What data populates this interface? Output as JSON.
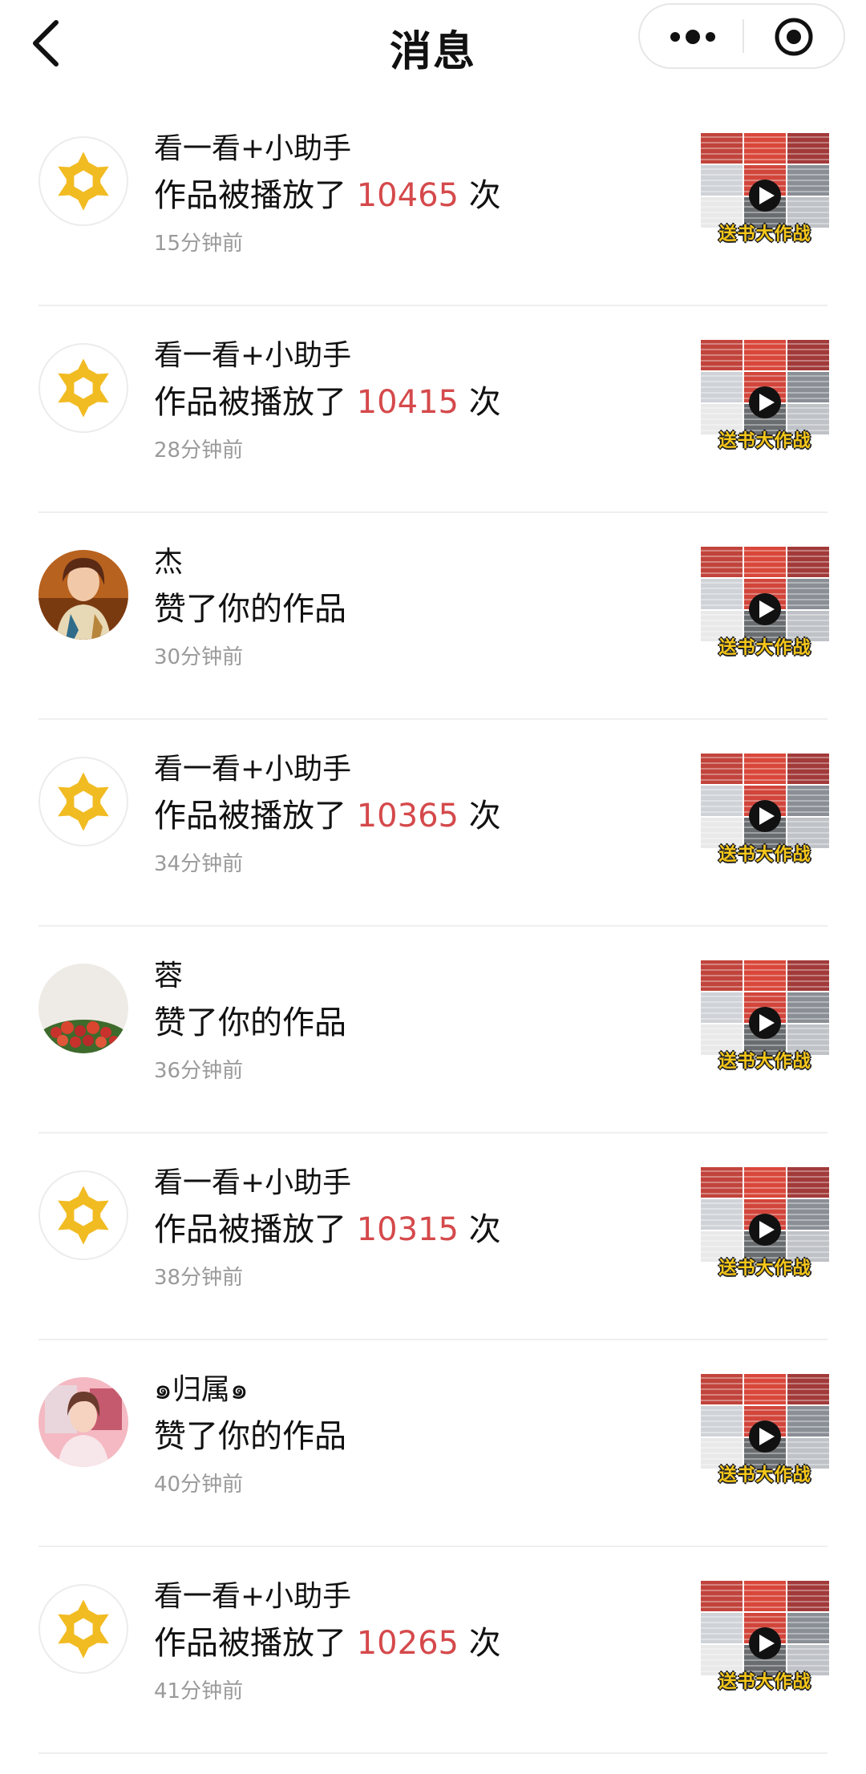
{
  "header": {
    "title": "消息",
    "back_icon": "back-icon",
    "menu_icon": "more-dots-icon",
    "close_icon": "record-icon"
  },
  "colors": {
    "accent_count": "#d5494b",
    "assistant_logo": "#f1bb22",
    "secondary_text": "#9a9a9a"
  },
  "thumbnail": {
    "caption": "送书大作战",
    "play_icon": "play-icon"
  },
  "messages": [
    {
      "sender": "看一看+小助手",
      "text_prefix": "作品被播放了 ",
      "count": "10465",
      "text_suffix": " 次",
      "time": "15分钟前",
      "avatar": "assistant-logo"
    },
    {
      "sender": "看一看+小助手",
      "text_prefix": "作品被播放了 ",
      "count": "10415",
      "text_suffix": " 次",
      "time": "28分钟前",
      "avatar": "assistant-logo"
    },
    {
      "sender": "杰",
      "text": "赞了你的作品",
      "time": "30分钟前",
      "avatar": "user-photo"
    },
    {
      "sender": "看一看+小助手",
      "text_prefix": "作品被播放了 ",
      "count": "10365",
      "text_suffix": " 次",
      "time": "34分钟前",
      "avatar": "assistant-logo"
    },
    {
      "sender": "蓉",
      "text": "赞了你的作品",
      "time": "36分钟前",
      "avatar": "user-photo"
    },
    {
      "sender": "看一看+小助手",
      "text_prefix": "作品被播放了 ",
      "count": "10315",
      "text_suffix": " 次",
      "time": "38分钟前",
      "avatar": "assistant-logo"
    },
    {
      "sender": "๑归属๑",
      "text": "赞了你的作品",
      "time": "40分钟前",
      "avatar": "user-photo"
    },
    {
      "sender": "看一看+小助手",
      "text_prefix": "作品被播放了 ",
      "count": "10265",
      "text_suffix": " 次",
      "time": "41分钟前",
      "avatar": "assistant-logo"
    }
  ]
}
